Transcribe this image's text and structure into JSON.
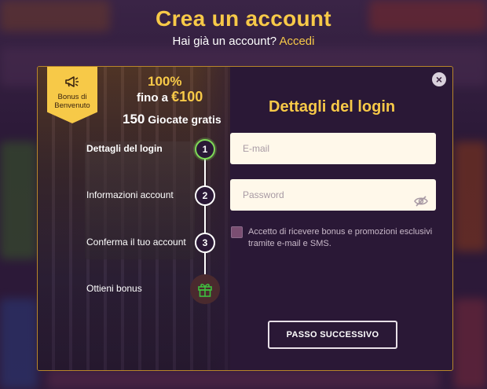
{
  "header": {
    "title": "Crea un account",
    "subtitle_text": "Hai già un account?",
    "login_link": "Accedi"
  },
  "promo": {
    "badge_label": "Bonus di Benvenuto",
    "badge_icon": "megaphone-icon",
    "percent": "100%",
    "up_to": "fino a",
    "amount": "€100",
    "spins_number": "150",
    "spins_text": "Giocate gratis"
  },
  "steps": [
    {
      "label": "Dettagli del login",
      "number": "1",
      "active": true
    },
    {
      "label": "Informazioni account",
      "number": "2",
      "active": false
    },
    {
      "label": "Conferma il tuo account",
      "number": "3",
      "active": false
    },
    {
      "label": "Ottieni bonus",
      "icon": "gift-icon",
      "active": false
    }
  ],
  "form": {
    "title": "Dettagli del login",
    "email_placeholder": "E-mail",
    "email_value": "",
    "password_placeholder": "Password",
    "password_value": "",
    "consent_checked": false,
    "consent_text": "Accetto di ricevere bonus e promozioni esclusivi tramite e-mail e SMS.",
    "next_button": "PASSO SUCCESSIVO",
    "close_icon": "close-icon"
  },
  "colors": {
    "accent": "#f7c948",
    "background": "#2a1836",
    "active_step": "#7ed957",
    "gift": "#3fbf3f"
  }
}
